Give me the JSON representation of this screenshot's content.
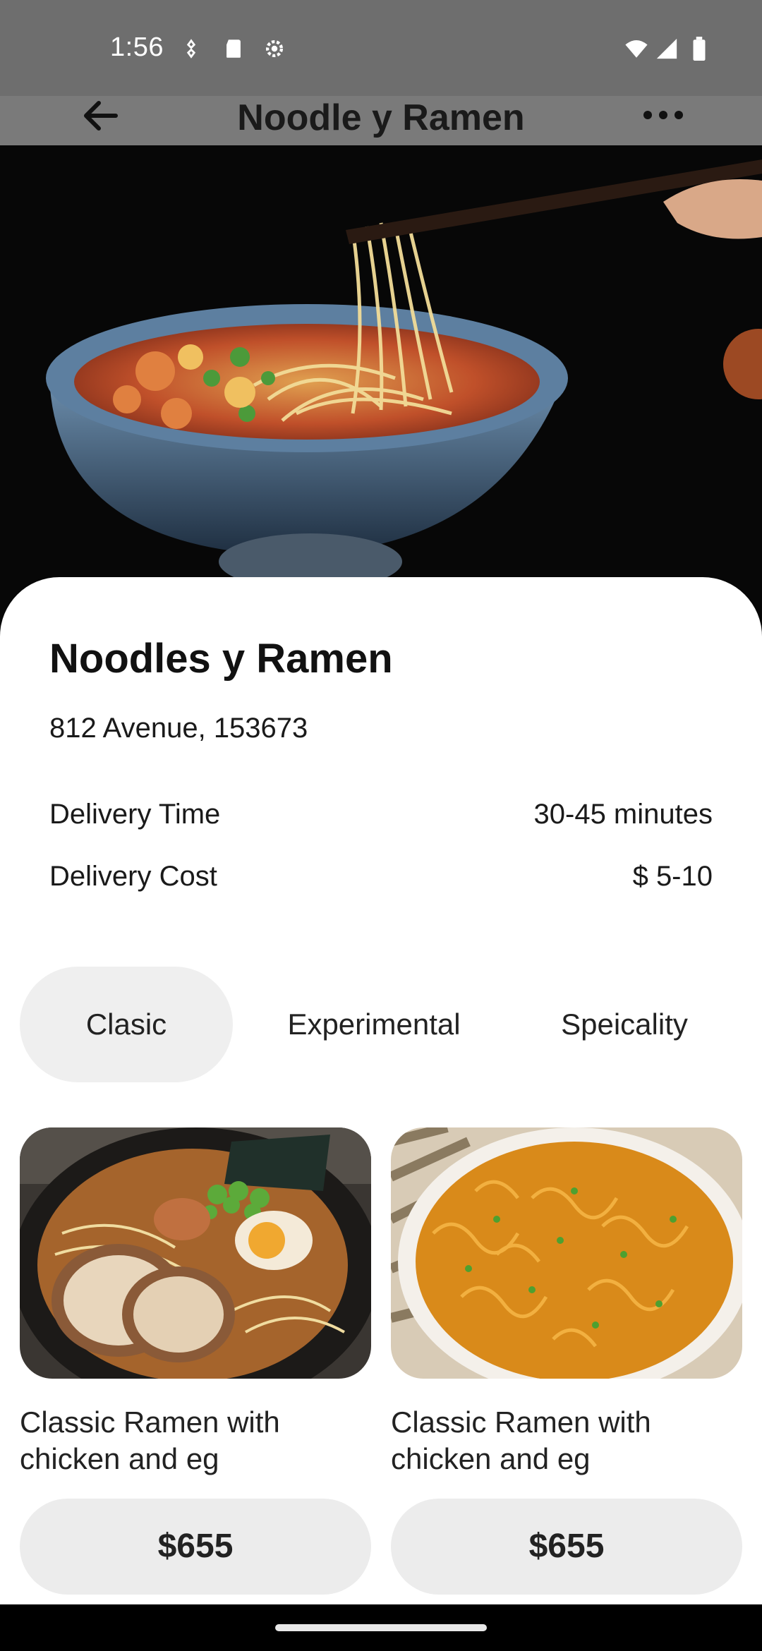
{
  "status_bar": {
    "time": "1:56",
    "left_icons": [
      "hotspot-icon",
      "sd-card-icon",
      "settings-gear-icon"
    ],
    "right_icons": [
      "wifi-icon",
      "signal-icon",
      "battery-icon"
    ]
  },
  "app_bar": {
    "title": "Noodle y Ramen",
    "back_icon": "arrow-left-icon",
    "more_icon": "more-horizontal-icon"
  },
  "hero": {
    "image": "ramen bowl with chopsticks lifting noodles"
  },
  "restaurant": {
    "name": "Noodles y Ramen",
    "address": "812 Avenue, 153673",
    "delivery_time_label": "Delivery Time",
    "delivery_time_value": "30-45 minutes",
    "delivery_cost_label": "Delivery Cost",
    "delivery_cost_value": "$ 5-10"
  },
  "tabs": [
    {
      "label": "Clasic",
      "active": true
    },
    {
      "label": "Experimental",
      "active": false
    },
    {
      "label": "Speicality",
      "active": false
    }
  ],
  "products": [
    {
      "name": "Classic Ramen with chicken and eg",
      "price": "$655",
      "image": "tonkotsu ramen bowl"
    },
    {
      "name": "Classic Ramen with chicken and eg",
      "price": "$655",
      "image": "fried noodles bowl"
    }
  ],
  "colors": {
    "status_bar": "#6e6e6e",
    "app_bar": "#7a7a7a",
    "tab_active_bg": "#efefef",
    "price_button_bg": "#ececec"
  }
}
